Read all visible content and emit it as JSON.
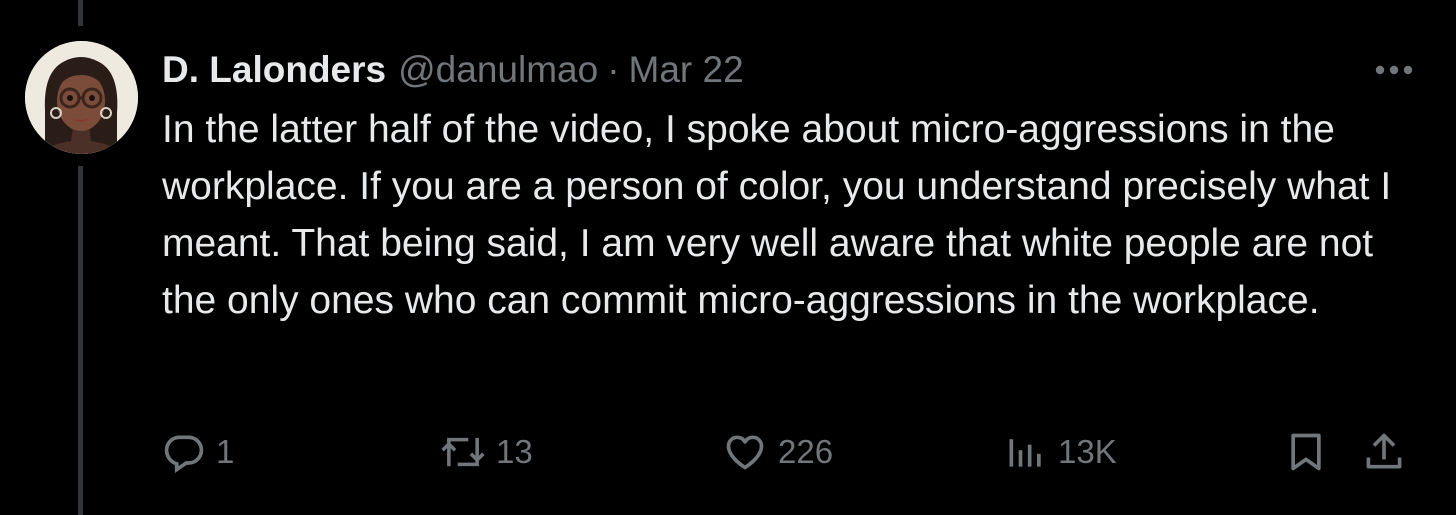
{
  "author": {
    "display_name": "D. Lalonders",
    "handle": "@danulmao",
    "separator": "·",
    "date": "Mar 22",
    "avatar_icon": "avatar-illustration"
  },
  "tweet": {
    "text": "In the latter half of the video, I spoke about micro-aggressions in the workplace. If you are a person of color, you understand precisely what I meant. That being said, I am very well aware that white people are not the only ones who can commit micro-aggressions in the workplace."
  },
  "actions": {
    "reply": {
      "icon": "reply-icon",
      "count": "1"
    },
    "retweet": {
      "icon": "retweet-icon",
      "count": "13"
    },
    "like": {
      "icon": "heart-icon",
      "count": "226"
    },
    "views": {
      "icon": "views-icon",
      "count": "13K"
    },
    "bookmark": {
      "icon": "bookmark-icon"
    },
    "share": {
      "icon": "share-icon"
    }
  },
  "colors": {
    "background": "#000000",
    "text_primary": "#e7e9ea",
    "text_secondary": "#71767b",
    "thread_line": "#333639"
  }
}
